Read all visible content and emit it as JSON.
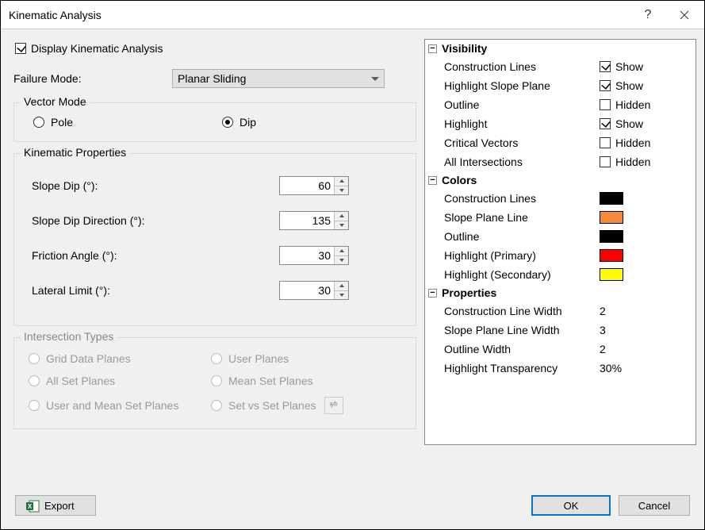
{
  "window": {
    "title": "Kinematic Analysis",
    "help_tooltip": "?",
    "close_tooltip": "Close"
  },
  "display_checkbox": {
    "label": "Display Kinematic Analysis",
    "checked": true
  },
  "failure_mode": {
    "label": "Failure Mode:",
    "selected": "Planar Sliding"
  },
  "vector_mode": {
    "legend": "Vector Mode",
    "options": [
      {
        "label": "Pole",
        "selected": false
      },
      {
        "label": "Dip",
        "selected": true
      }
    ]
  },
  "kinematic_properties": {
    "legend": "Kinematic Properties",
    "rows": [
      {
        "label": "Slope Dip (°):",
        "value": "60"
      },
      {
        "label": "Slope Dip Direction (°):",
        "value": "135"
      },
      {
        "label": "Friction Angle (°):",
        "value": "30"
      },
      {
        "label": "Lateral Limit (°):",
        "value": "30"
      }
    ]
  },
  "intersection_types": {
    "legend": "Intersection Types",
    "options": [
      "Grid Data Planes",
      "User Planes",
      "All Set Planes",
      "Mean Set Planes",
      "User and Mean Set Planes",
      "Set vs Set Planes"
    ],
    "mini_button": "ᵃ⁄ᵇ"
  },
  "tree": {
    "sections": [
      {
        "title": "Visibility",
        "rows": [
          {
            "label": "Construction Lines",
            "checked": true,
            "text": "Show"
          },
          {
            "label": "Highlight Slope Plane",
            "checked": true,
            "text": "Show"
          },
          {
            "label": "Outline",
            "checked": false,
            "text": "Hidden"
          },
          {
            "label": "Highlight",
            "checked": true,
            "text": "Show"
          },
          {
            "label": "Critical Vectors",
            "checked": false,
            "text": "Hidden"
          },
          {
            "label": "All Intersections",
            "checked": false,
            "text": "Hidden"
          }
        ]
      },
      {
        "title": "Colors",
        "rows": [
          {
            "label": "Construction Lines",
            "color": "#000000"
          },
          {
            "label": "Slope Plane Line",
            "color": "#f58a3c"
          },
          {
            "label": "Outline",
            "color": "#000000"
          },
          {
            "label": "Highlight (Primary)",
            "color": "#ff0000"
          },
          {
            "label": "Highlight (Secondary)",
            "color": "#ffff00"
          }
        ]
      },
      {
        "title": "Properties",
        "rows": [
          {
            "label": "Construction Line Width",
            "value": "2"
          },
          {
            "label": "Slope Plane Line Width",
            "value": "3"
          },
          {
            "label": "Outline Width",
            "value": "2"
          },
          {
            "label": "Highlight Transparency",
            "value": "30%"
          }
        ]
      }
    ]
  },
  "footer": {
    "export": "Export",
    "ok": "OK",
    "cancel": "Cancel"
  }
}
